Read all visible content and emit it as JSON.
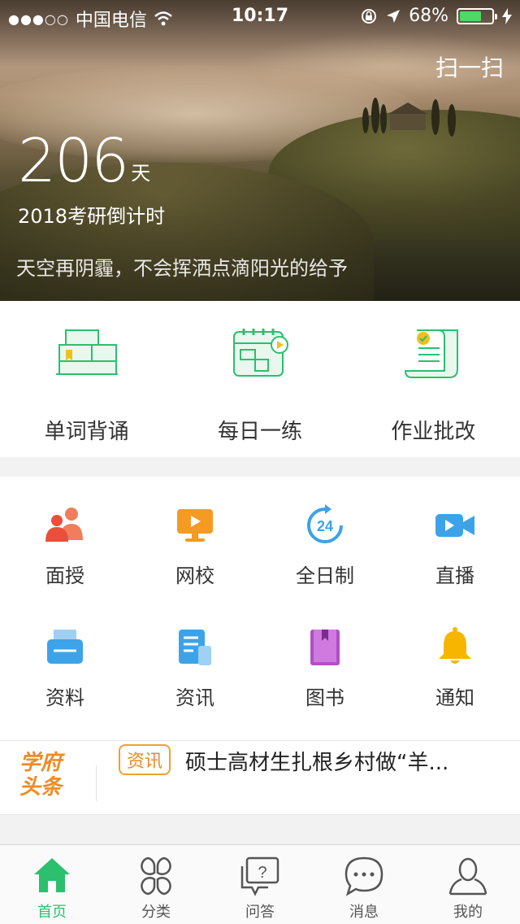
{
  "status_bar": {
    "signal": "●●●○○",
    "carrier": "中国电信",
    "time": "10:17",
    "battery": "68%",
    "battery_level": 0.68,
    "icons": [
      "wifi-icon",
      "lock-rotation-icon",
      "location-arrow-icon",
      "battery-icon",
      "charging-icon"
    ]
  },
  "hero": {
    "scan_label": "扫一扫",
    "days": "206",
    "days_unit": "天",
    "subtitle": "2018考研倒计时",
    "motto": "天空再阴霾，不会挥洒点滴阳光的给予"
  },
  "features": [
    {
      "label": "单词背诵",
      "icon": "book-stack-icon"
    },
    {
      "label": "每日一练",
      "icon": "calendar-play-icon"
    },
    {
      "label": "作业批改",
      "icon": "scroll-check-icon"
    }
  ],
  "grid": [
    {
      "label": "面授",
      "icon": "people-icon"
    },
    {
      "label": "网校",
      "icon": "monitor-play-icon"
    },
    {
      "label": "全日制",
      "icon": "24-hour-icon"
    },
    {
      "label": "直播",
      "icon": "video-camera-icon"
    },
    {
      "label": "资料",
      "icon": "printer-icon"
    },
    {
      "label": "资讯",
      "icon": "document-icon"
    },
    {
      "label": "图书",
      "icon": "book-icon"
    },
    {
      "label": "通知",
      "icon": "bell-icon"
    }
  ],
  "news": {
    "brand_line1": "学府",
    "brand_line2": "头条",
    "tag": "资讯",
    "title": "硕士高材生扎根乡村做“羊..."
  },
  "tabbar": [
    {
      "label": "首页",
      "icon": "home-icon",
      "active": true
    },
    {
      "label": "分类",
      "icon": "category-icon",
      "active": false
    },
    {
      "label": "问答",
      "icon": "question-bubble-icon",
      "active": false
    },
    {
      "label": "消息",
      "icon": "message-icon",
      "active": false
    },
    {
      "label": "我的",
      "icon": "profile-icon",
      "active": false
    }
  ],
  "colors": {
    "accent_green": "#2cbf6e",
    "tag_orange": "#f08a24",
    "battery_green": "#4cd964"
  }
}
